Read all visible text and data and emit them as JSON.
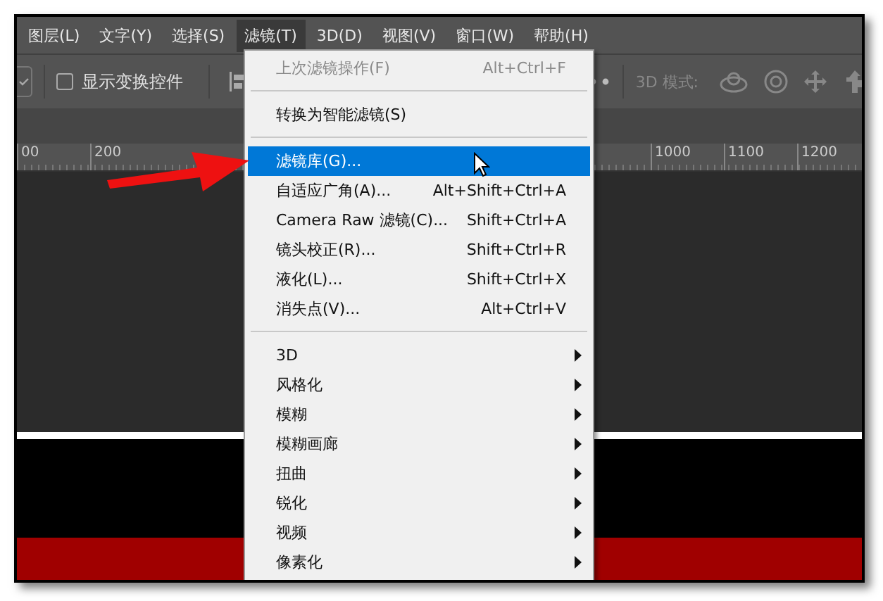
{
  "menu_bar": [
    {
      "label": "图层(L)",
      "selected": false
    },
    {
      "label": "文字(Y)",
      "selected": false
    },
    {
      "label": "选择(S)",
      "selected": false
    },
    {
      "label": "滤镜(T)",
      "selected": true
    },
    {
      "label": "3D(D)",
      "selected": false
    },
    {
      "label": "视图(V)",
      "selected": false
    },
    {
      "label": "窗口(W)",
      "selected": false
    },
    {
      "label": "帮助(H)",
      "selected": false
    }
  ],
  "options_bar": {
    "show_transform_controls": {
      "label": "显示变换控件",
      "checked": false
    },
    "mode_label": "3D 模式:"
  },
  "ruler": {
    "left_labels": [
      "00",
      "200"
    ],
    "right_labels": [
      "1000",
      "1100",
      "1200"
    ]
  },
  "filter_menu": [
    {
      "kind": "item",
      "label": "上次滤镜操作(F)",
      "shortcut": "Alt+Ctrl+F",
      "disabled": true,
      "selected": false
    },
    {
      "kind": "separator"
    },
    {
      "kind": "item",
      "label": "转换为智能滤镜(S)",
      "disabled": false,
      "selected": false
    },
    {
      "kind": "separator"
    },
    {
      "kind": "item",
      "label": "滤镜库(G)...",
      "disabled": false,
      "selected": true
    },
    {
      "kind": "item",
      "label": "自适应广角(A)...",
      "shortcut": "Alt+Shift+Ctrl+A",
      "disabled": false,
      "selected": false
    },
    {
      "kind": "item",
      "label": "Camera Raw 滤镜(C)...",
      "shortcut": "Shift+Ctrl+A",
      "disabled": false,
      "selected": false
    },
    {
      "kind": "item",
      "label": "镜头校正(R)...",
      "shortcut": "Shift+Ctrl+R",
      "disabled": false,
      "selected": false
    },
    {
      "kind": "item",
      "label": "液化(L)...",
      "shortcut": "Shift+Ctrl+X",
      "disabled": false,
      "selected": false
    },
    {
      "kind": "item",
      "label": "消失点(V)...",
      "shortcut": "Alt+Ctrl+V",
      "disabled": false,
      "selected": false
    },
    {
      "kind": "separator"
    },
    {
      "kind": "submenu",
      "label": "3D",
      "disabled": false,
      "selected": false
    },
    {
      "kind": "submenu",
      "label": "风格化",
      "disabled": false,
      "selected": false
    },
    {
      "kind": "submenu",
      "label": "模糊",
      "disabled": false,
      "selected": false
    },
    {
      "kind": "submenu",
      "label": "模糊画廊",
      "disabled": false,
      "selected": false
    },
    {
      "kind": "submenu",
      "label": "扭曲",
      "disabled": false,
      "selected": false
    },
    {
      "kind": "submenu",
      "label": "锐化",
      "disabled": false,
      "selected": false
    },
    {
      "kind": "submenu",
      "label": "视频",
      "disabled": false,
      "selected": false
    },
    {
      "kind": "submenu",
      "label": "像素化",
      "disabled": false,
      "selected": false
    }
  ]
}
